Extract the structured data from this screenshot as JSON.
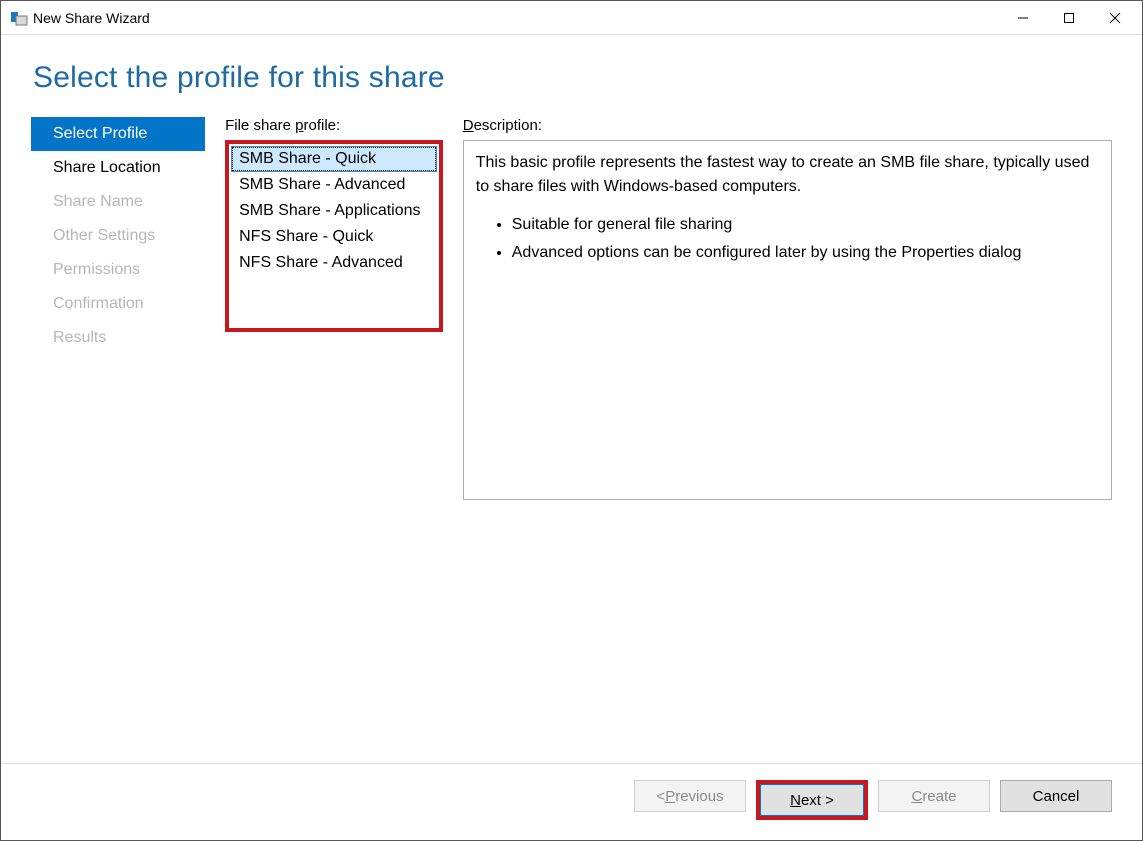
{
  "window": {
    "title": "New Share Wizard"
  },
  "page": {
    "heading": "Select the profile for this share"
  },
  "steps": [
    {
      "label": "Select Profile",
      "state": "active"
    },
    {
      "label": "Share Location",
      "state": "available"
    },
    {
      "label": "Share Name",
      "state": "disabled"
    },
    {
      "label": "Other Settings",
      "state": "disabled"
    },
    {
      "label": "Permissions",
      "state": "disabled"
    },
    {
      "label": "Confirmation",
      "state": "disabled"
    },
    {
      "label": "Results",
      "state": "disabled"
    }
  ],
  "profileList": {
    "label_pre": "File share ",
    "label_ul": "p",
    "label_post": "rofile:",
    "items": [
      {
        "label": "SMB Share - Quick",
        "selected": true
      },
      {
        "label": "SMB Share - Advanced",
        "selected": false
      },
      {
        "label": "SMB Share - Applications",
        "selected": false
      },
      {
        "label": "NFS Share - Quick",
        "selected": false
      },
      {
        "label": "NFS Share - Advanced",
        "selected": false
      }
    ]
  },
  "description": {
    "label_ul": "D",
    "label_post": "escription:",
    "paragraph": "This basic profile represents the fastest way to create an SMB file share, typically used to share files with Windows-based computers.",
    "bullets": [
      "Suitable for general file sharing",
      "Advanced options can be configured later by using the Properties dialog"
    ]
  },
  "buttons": {
    "previous_pre": "< ",
    "previous_ul": "P",
    "previous_post": "revious",
    "next_ul": "N",
    "next_post": "ext >",
    "create_ul": "C",
    "create_post": "reate",
    "cancel": "Cancel"
  }
}
